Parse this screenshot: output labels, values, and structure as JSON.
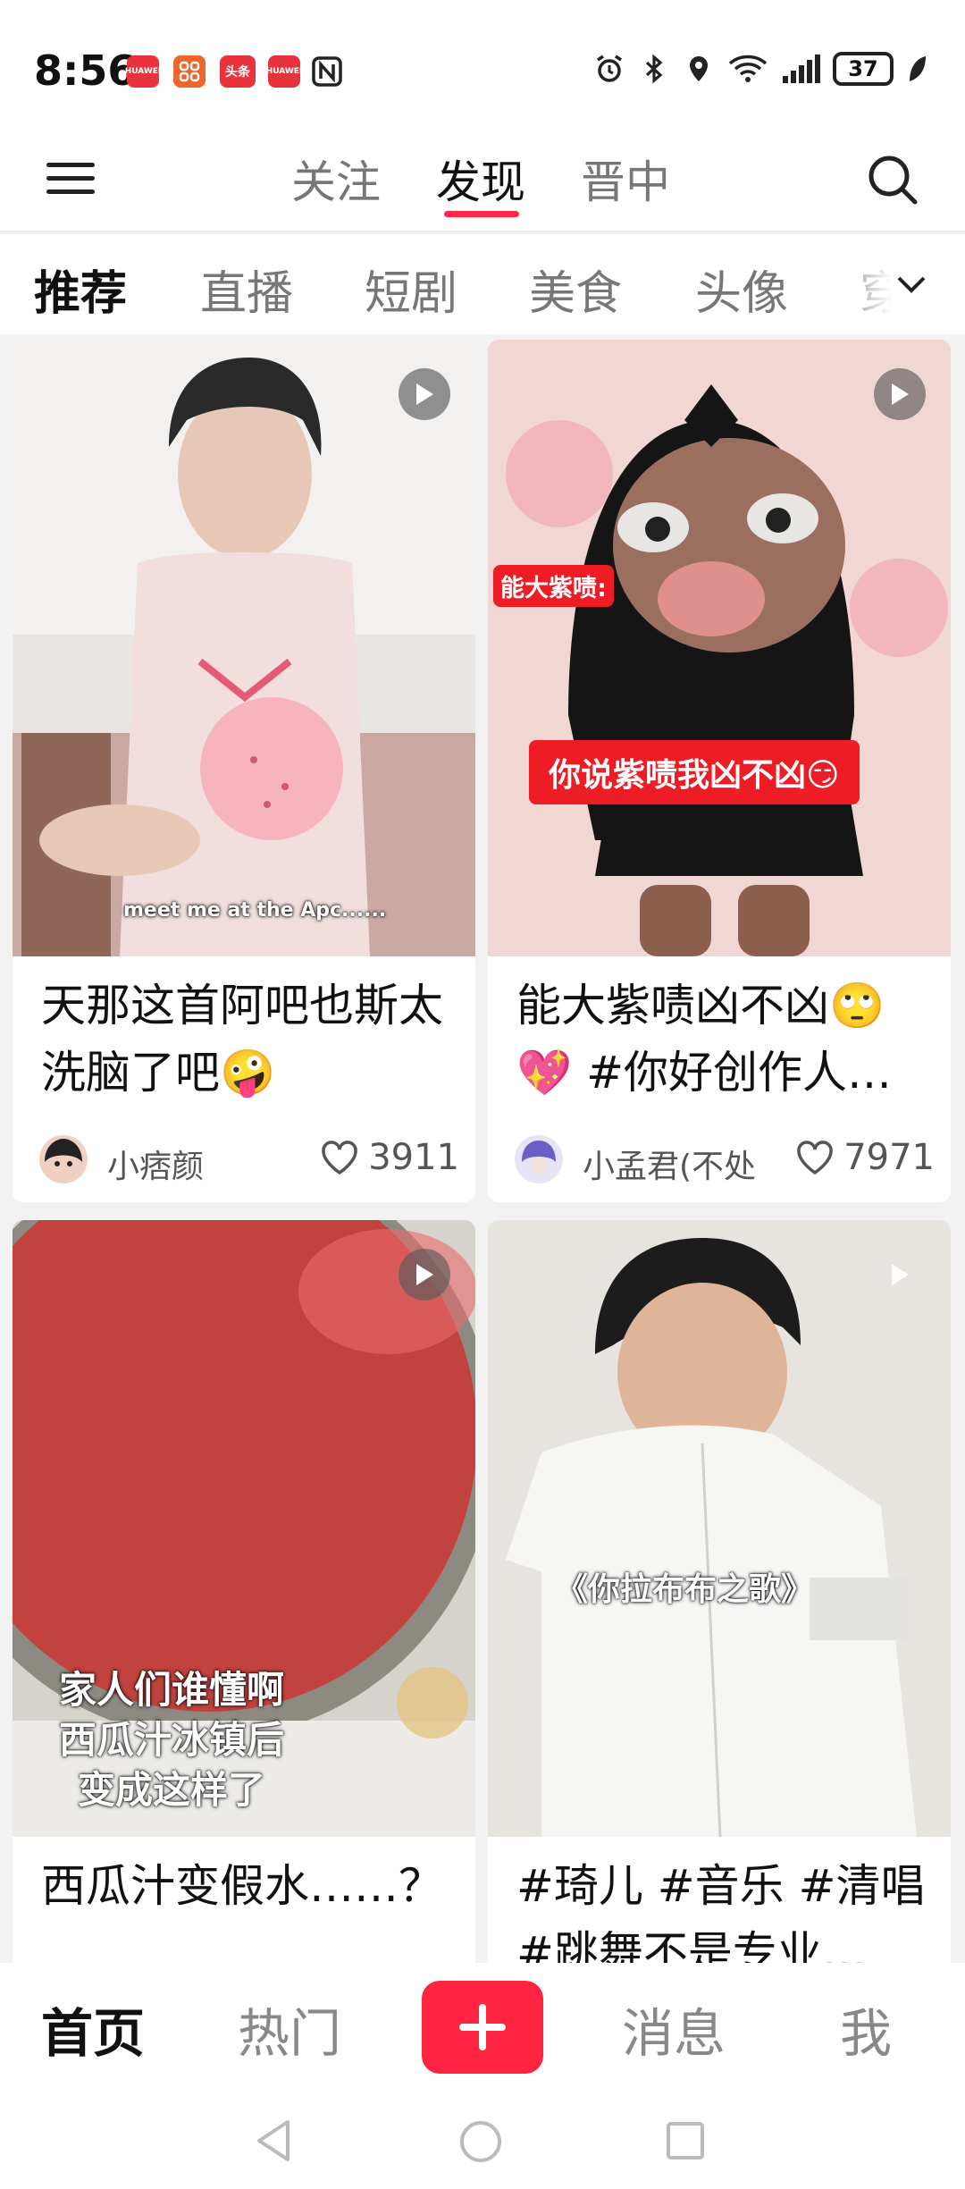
{
  "status_bar": {
    "time": "8:56",
    "badges": [
      {
        "name": "huawei-store-badge",
        "text": "HUAWEI",
        "color": "#e8323c"
      },
      {
        "name": "app-grid-badge",
        "text": "",
        "color": "#f0652a"
      },
      {
        "name": "toutiao-badge",
        "text": "头条",
        "color": "#e8323c"
      },
      {
        "name": "huawei-store-badge-2",
        "text": "HUAWEI",
        "color": "#e8323c"
      }
    ],
    "battery": "37"
  },
  "top_nav": {
    "tabs": [
      {
        "label": "关注",
        "active": false
      },
      {
        "label": "发现",
        "active": true
      },
      {
        "label": "晋中",
        "active": false
      }
    ]
  },
  "categories": [
    "推荐",
    "直播",
    "短剧",
    "美食",
    "头像",
    "穿"
  ],
  "feed": [
    {
      "title": "天那这首阿吧也斯太洗脑了吧🤪",
      "author": "小痞颜",
      "likes": "3911",
      "overlay": "meet me at the Apc......"
    },
    {
      "title": "能大紫啧凶不凶🙄💖 #你好创作人…",
      "author": "小孟君(不处",
      "likes": "7971",
      "label_tag": "能大紫啧:",
      "red_caption": "你说紫啧我凶不凶😏"
    },
    {
      "title": "西瓜汁变假水……？",
      "author": "",
      "likes": "",
      "overlay_lines": [
        "家人们谁懂啊",
        "西瓜汁冰镇后",
        "变成这样了"
      ]
    },
    {
      "title": "#琦儿 #音乐 #清唱 #跳舞不是专业…",
      "author": "",
      "likes": "",
      "overlay": "《你拉布布之歌》"
    }
  ],
  "bottom_nav": {
    "items": [
      {
        "label": "首页",
        "active": true
      },
      {
        "label": "热门",
        "active": false
      },
      {
        "label": "消息",
        "active": false
      },
      {
        "label": "我",
        "active": false
      }
    ],
    "accent": "#ff2442"
  },
  "colors": {
    "accent": "#ff2a4a"
  }
}
